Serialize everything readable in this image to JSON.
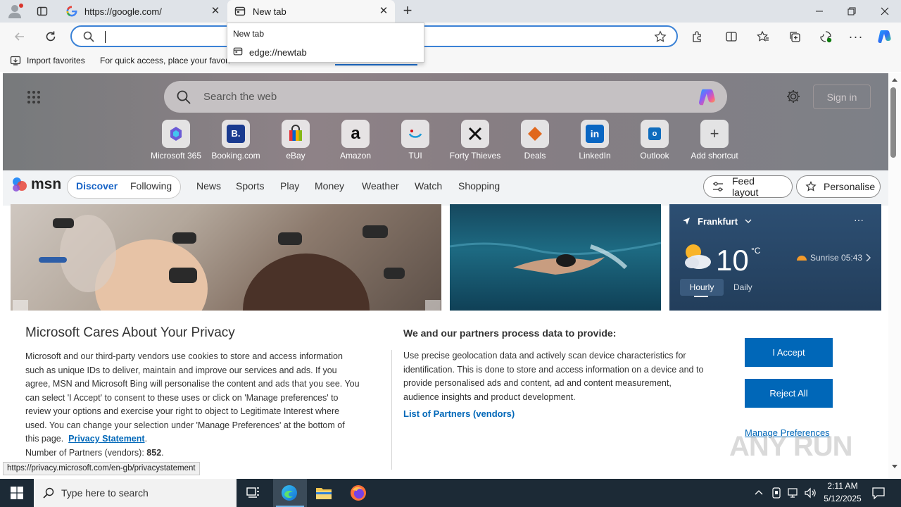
{
  "browser": {
    "tabs": [
      {
        "title": "https://google.com/",
        "icon": "google-g-icon"
      },
      {
        "title": "New tab",
        "icon": "newtab-icon"
      }
    ],
    "address_value": "",
    "dropdown": {
      "header": "New tab",
      "item": "edge://newtab"
    },
    "favorites_bar": {
      "import_label": "Import favorites",
      "hint": "For quick access, place your favori"
    }
  },
  "newtab": {
    "search_placeholder": "Search the web",
    "sign_in": "Sign in",
    "shortcuts": [
      {
        "label": "Microsoft 365"
      },
      {
        "label": "Booking.com"
      },
      {
        "label": "eBay"
      },
      {
        "label": "Amazon"
      },
      {
        "label": "TUI"
      },
      {
        "label": "Forty Thieves"
      },
      {
        "label": "Deals"
      },
      {
        "label": "LinkedIn"
      },
      {
        "label": "Outlook"
      },
      {
        "label": "Add shortcut"
      }
    ],
    "msn": {
      "logo": "msn",
      "tabs": [
        "Discover",
        "Following"
      ],
      "nav": [
        "News",
        "Sports",
        "Play",
        "Money",
        "Weather",
        "Watch",
        "Shopping"
      ],
      "feed_layout": "Feed layout",
      "personalise": "Personalise"
    },
    "weather": {
      "city": "Frankfurt",
      "temp": "10",
      "unit": "°C",
      "sunrise": "Sunrise 05:43",
      "tab_hourly": "Hourly",
      "tab_daily": "Daily"
    }
  },
  "privacy": {
    "title": "Microsoft Cares About Your Privacy",
    "body_lines": [
      "Microsoft and our third-party vendors use cookies to store and access information",
      "such as unique IDs to deliver, maintain and improve our services and ads. If you",
      "agree, MSN and Microsoft Bing will personalise the content and ads that you see. You",
      "can select 'I Accept' to consent to these uses or click on 'Manage preferences' to",
      "review your options and exercise your right to object to Legitimate Interest where",
      "used.  You can change your selection under 'Manage Preferences' at the bottom of"
    ],
    "last_line_prefix": "this page.",
    "privacy_link": "Privacy Statement",
    "partners_label": "Number of Partners (vendors): ",
    "partners_count": "852",
    "right_heading": "We and our partners process data to provide:",
    "right_lines": [
      "Use precise geolocation data and actively scan device characteristics for",
      "identification. This is done to store and access information on a device and to",
      "provide personalised ads and content, ad and content measurement,",
      "audience insights and product development."
    ],
    "vendors_link": "List of Partners (vendors)",
    "accept": "I Accept",
    "reject": "Reject All",
    "manage": "Manage Preferences"
  },
  "status_url": "https://privacy.microsoft.com/en-gb/privacystatement",
  "taskbar": {
    "search_placeholder": "Type here to search",
    "time": "2:11 AM",
    "date": "5/12/2025"
  },
  "watermark": "ANY RUN"
}
